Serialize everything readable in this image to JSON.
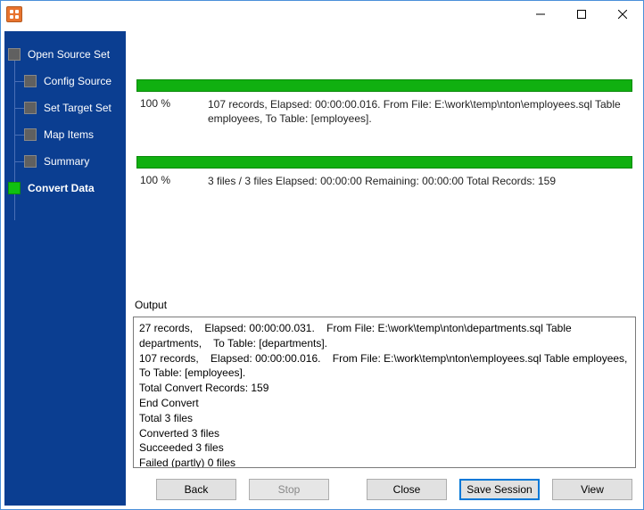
{
  "sidebar": {
    "items": [
      {
        "label": "Open Source Set"
      },
      {
        "label": "Config Source"
      },
      {
        "label": "Set Target Set"
      },
      {
        "label": "Map Items"
      },
      {
        "label": "Summary"
      },
      {
        "label": "Convert Data"
      }
    ]
  },
  "progress1": {
    "percent": "100 %",
    "summary": "107 records,    Elapsed: 00:00:00.016.    From File: E:\\work\\temp\\nton\\employees.sql Table employees,    To Table: [employees]."
  },
  "progress2": {
    "percent": "100 %",
    "summary": "3 files / 3 files    Elapsed: 00:00:00    Remaining: 00:00:00    Total Records: 159"
  },
  "output": {
    "label": "Output",
    "text": "27 records,    Elapsed: 00:00:00.031.    From File: E:\\work\\temp\\nton\\departments.sql Table departments,    To Table: [departments].\n107 records,    Elapsed: 00:00:00.016.    From File: E:\\work\\temp\\nton\\employees.sql Table employees,    To Table: [employees].\nTotal Convert Records: 159\nEnd Convert\nTotal 3 files\nConverted 3 files\nSucceeded 3 files\nFailed (partly) 0 files"
  },
  "buttons": {
    "back": "Back",
    "stop": "Stop",
    "close": "Close",
    "save": "Save Session",
    "view": "View"
  }
}
